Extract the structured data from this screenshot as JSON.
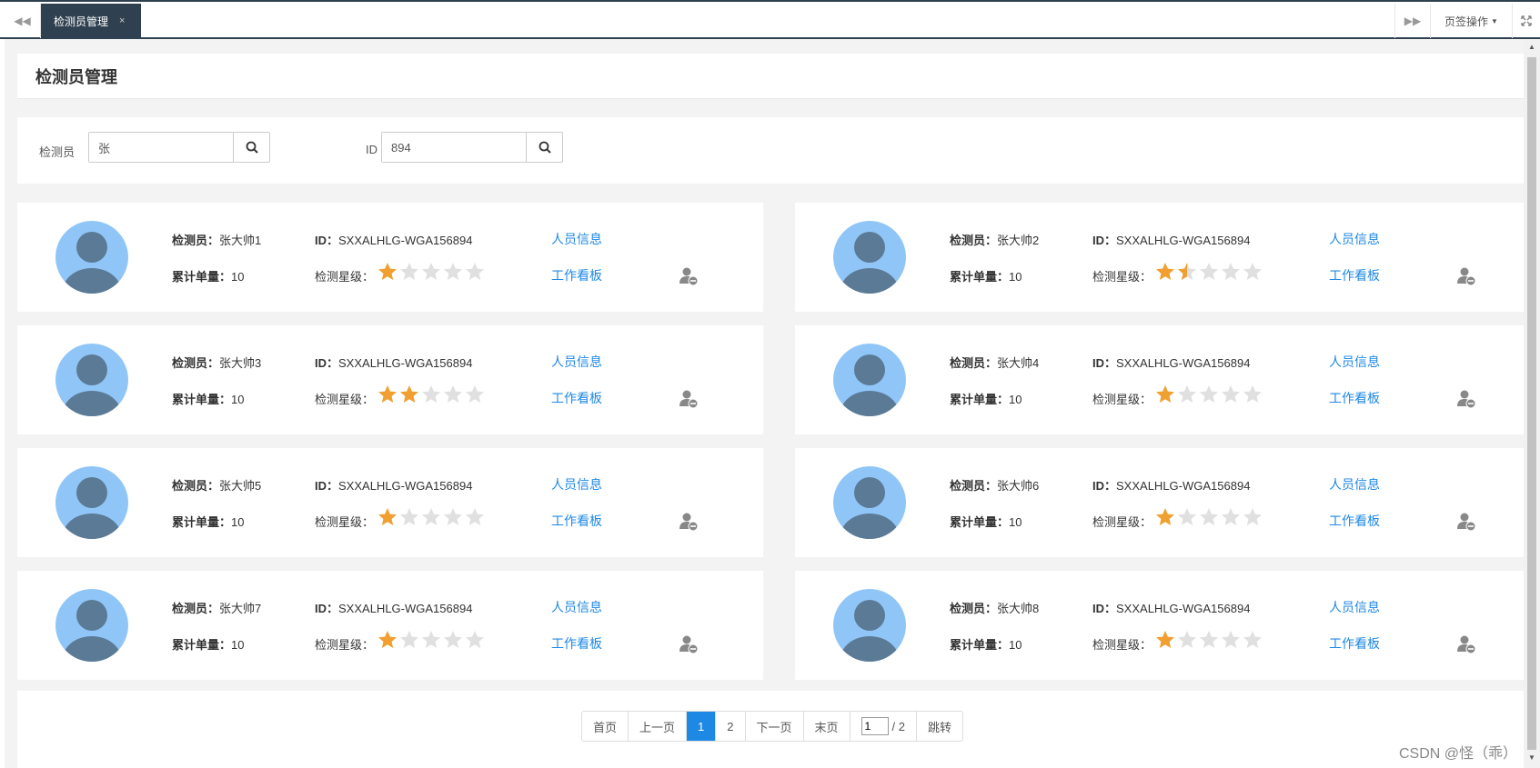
{
  "tabs": {
    "active_label": "检测员管理",
    "close_icon": "×",
    "ops_label": "页签操作"
  },
  "page_title": "检测员管理",
  "search": {
    "inspector_label": "检测员",
    "inspector_value": "张",
    "id_label": "ID",
    "id_value": "894"
  },
  "labels": {
    "inspector": "检测员：",
    "id": "ID：",
    "total_orders": "累计单量：",
    "rating": "检测星级：",
    "person_info": "人员信息",
    "work_board": "工作看板"
  },
  "cards": [
    {
      "name": "张大帅1",
      "id": "SXXALHLG-WGA156894",
      "orders": "10",
      "stars": 1
    },
    {
      "name": "张大帅2",
      "id": "SXXALHLG-WGA156894",
      "orders": "10",
      "stars": 1.5
    },
    {
      "name": "张大帅3",
      "id": "SXXALHLG-WGA156894",
      "orders": "10",
      "stars": 2
    },
    {
      "name": "张大帅4",
      "id": "SXXALHLG-WGA156894",
      "orders": "10",
      "stars": 1
    },
    {
      "name": "张大帅5",
      "id": "SXXALHLG-WGA156894",
      "orders": "10",
      "stars": 1
    },
    {
      "name": "张大帅6",
      "id": "SXXALHLG-WGA156894",
      "orders": "10",
      "stars": 1
    },
    {
      "name": "张大帅7",
      "id": "SXXALHLG-WGA156894",
      "orders": "10",
      "stars": 1
    },
    {
      "name": "张大帅8",
      "id": "SXXALHLG-WGA156894",
      "orders": "10",
      "stars": 1
    }
  ],
  "pagination": {
    "first": "首页",
    "prev": "上一页",
    "page1": "1",
    "page2": "2",
    "next": "下一页",
    "last": "末页",
    "jump_value": "1",
    "total": "/ 2",
    "jump": "跳转"
  },
  "colors": {
    "star_on": "#f0a030",
    "star_off": "#e0e0e0",
    "link": "#1e88e5",
    "tab_dark": "#2f4050"
  },
  "watermark": "CSDN @怪（乖）"
}
